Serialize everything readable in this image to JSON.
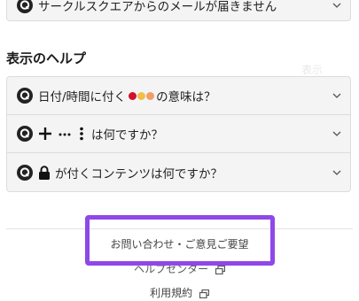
{
  "faq_top": {
    "text": "サークルスクエアからのメールが届きません"
  },
  "display_help": {
    "heading": "表示のヘルプ",
    "items": [
      {
        "prefix": "日付/時間に付く",
        "suffix": "の意味は？",
        "dot_colors": [
          "#d2112b",
          "#f0bf47",
          "#f29c6a"
        ]
      },
      {
        "suffix": "は何ですか？",
        "symbols": [
          "+",
          "…",
          "⋮"
        ]
      },
      {
        "suffix": "が付くコンテンツは何ですか？"
      }
    ]
  },
  "footer": {
    "contact": "お問い合わせ・ご意見ご要望",
    "help_center": "ヘルプセンター",
    "terms": "利用規約"
  },
  "colors": {
    "highlight": "#8f47e8",
    "row_bg": "#f4f4f4"
  }
}
